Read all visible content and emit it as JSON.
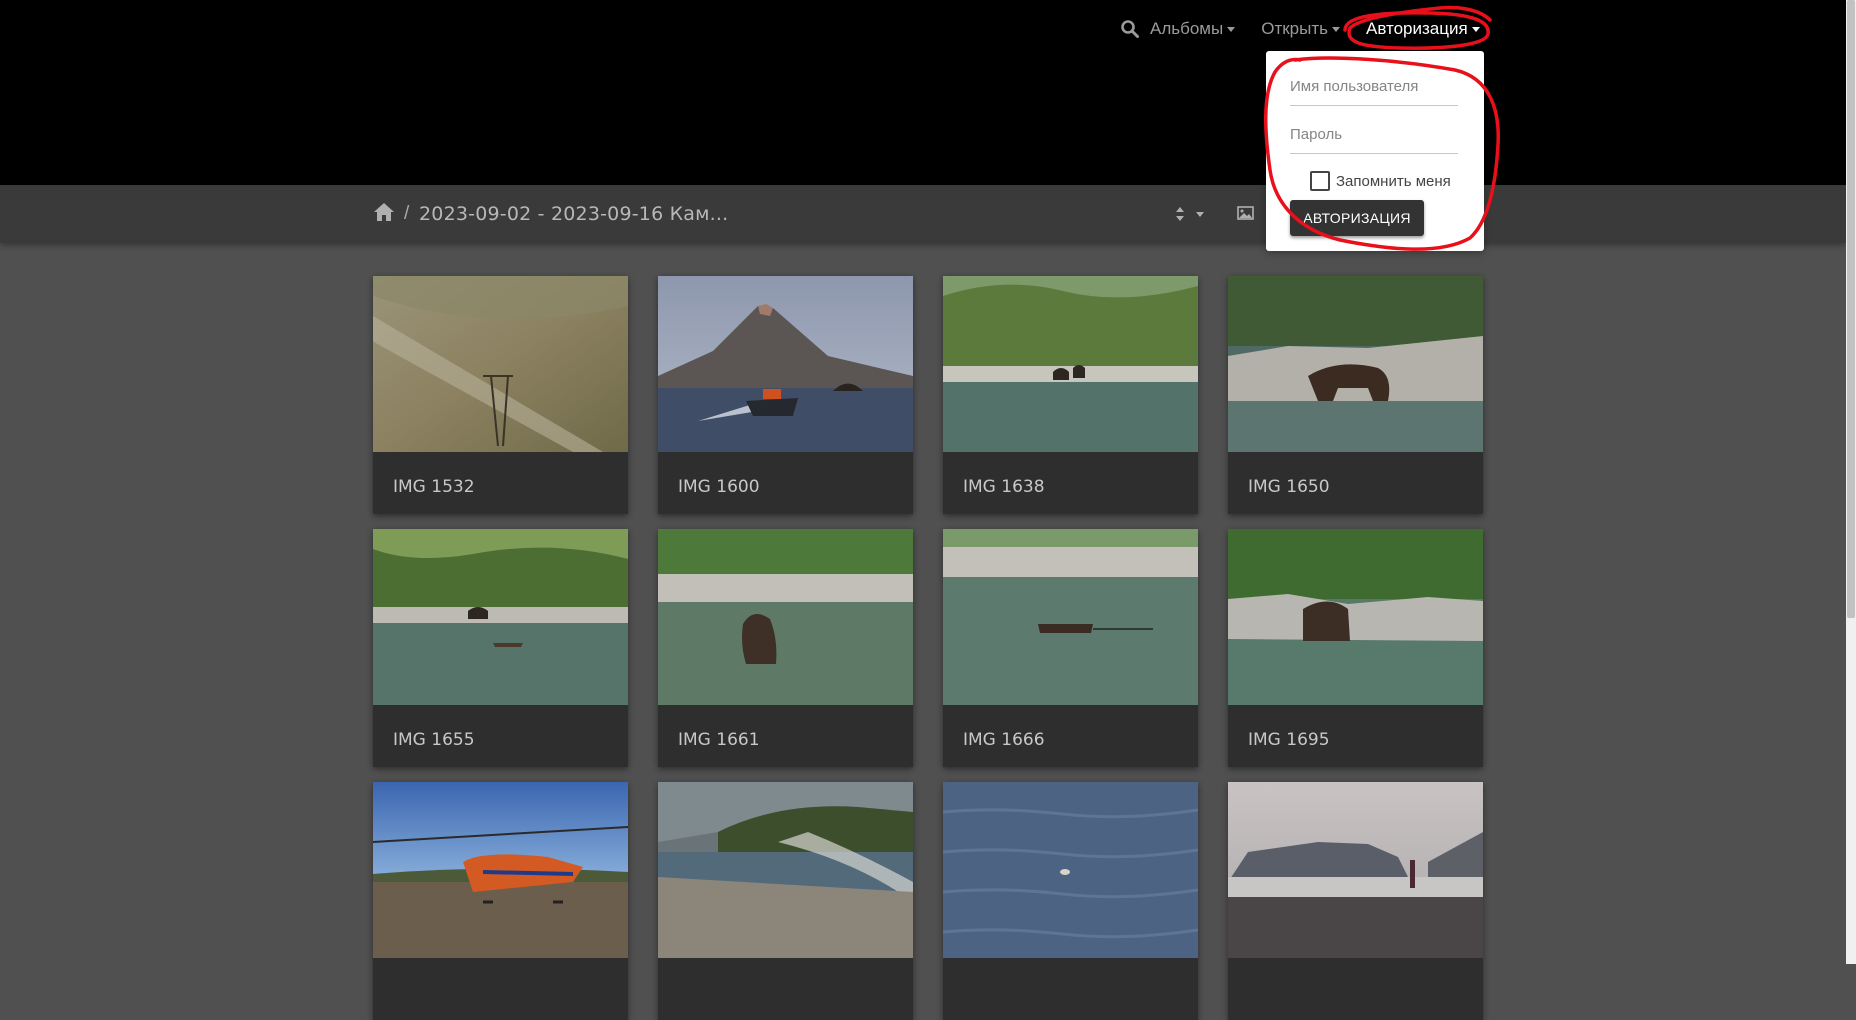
{
  "nav": {
    "search_icon": "search-icon",
    "albums": "Альбомы",
    "open": "Открыть",
    "auth": "Авторизация"
  },
  "breadcrumb": {
    "home_icon": "home-icon",
    "separator": "/",
    "album": "2023-09-02 - 2023-09-16 Кам..."
  },
  "toolbar": {
    "sort_icon": "sort-icon",
    "image_icon": "image-icon"
  },
  "login": {
    "username_placeholder": "Имя пользователя",
    "password_placeholder": "Пароль",
    "remember_label": "Запомнить меня",
    "submit_label": "АВТОРИЗАЦИЯ"
  },
  "thumbs": [
    {
      "caption": "IMG 1532"
    },
    {
      "caption": "IMG 1600"
    },
    {
      "caption": "IMG 1638"
    },
    {
      "caption": "IMG 1650"
    },
    {
      "caption": "IMG 1655"
    },
    {
      "caption": "IMG 1661"
    },
    {
      "caption": "IMG 1666"
    },
    {
      "caption": "IMG 1695"
    },
    {
      "caption": ""
    },
    {
      "caption": ""
    },
    {
      "caption": ""
    },
    {
      "caption": ""
    }
  ],
  "colors": {
    "annotation": "#e8101a",
    "header_bg": "#000000",
    "page_bg": "#505050"
  }
}
